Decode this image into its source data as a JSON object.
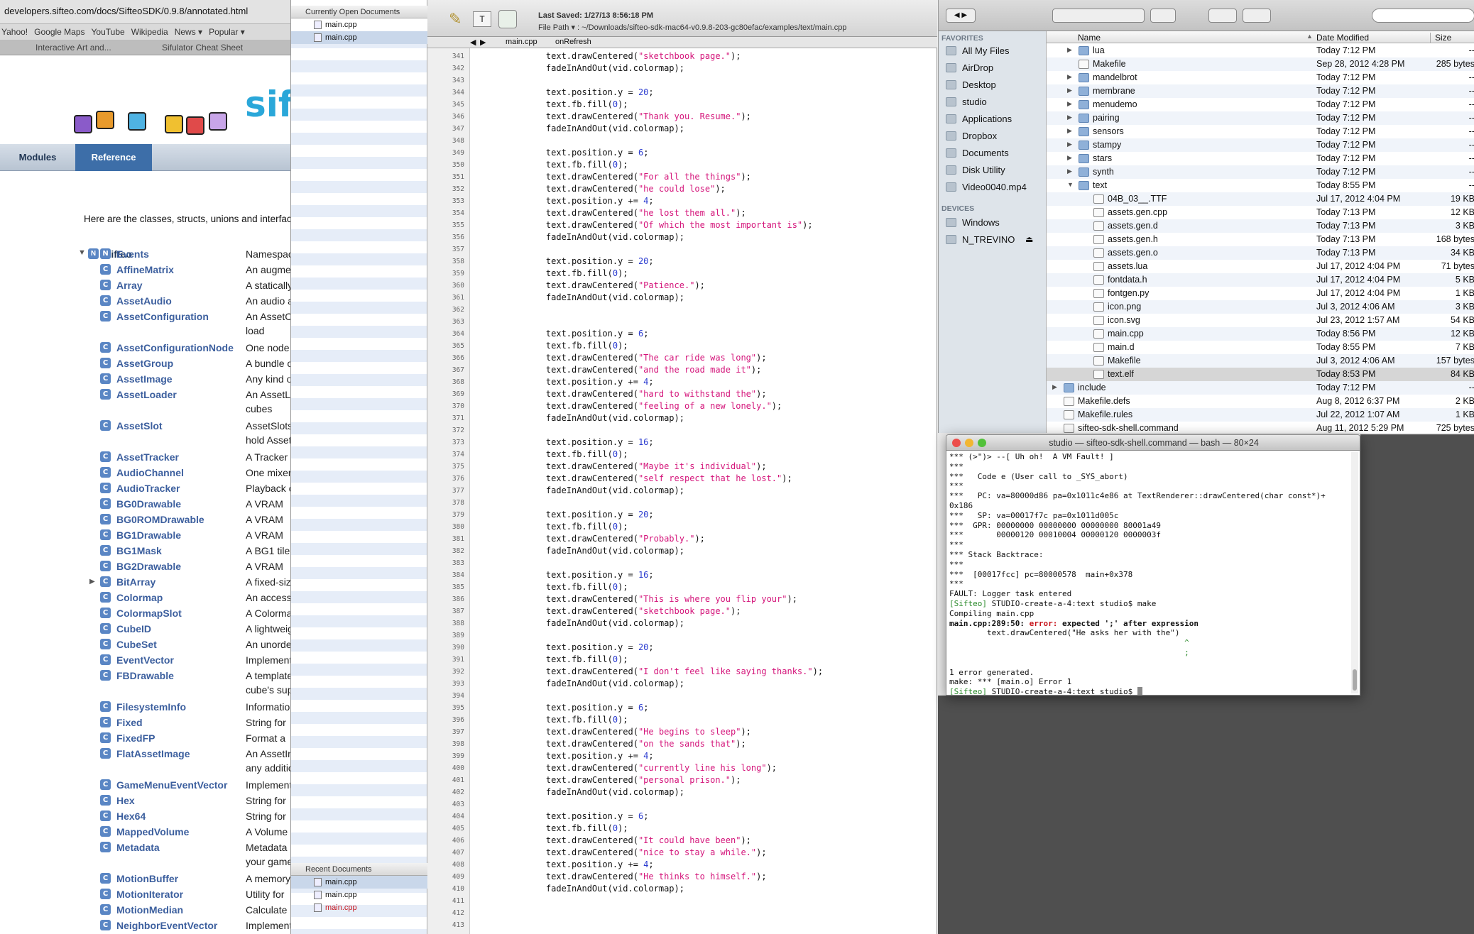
{
  "browser": {
    "url": "developers.sifteo.com/docs/SifteoSDK/0.9.8/annotated.html",
    "bookmarks": [
      "Yahoo!",
      "Google Maps",
      "YouTube",
      "Wikipedia",
      "News ▾",
      "Popular ▾"
    ],
    "tabs": [
      "Interactive Art and...",
      "Sifulator Cheat Sheet"
    ],
    "logo_text": "sift",
    "nav": {
      "modules": "Modules",
      "reference": "Reference"
    },
    "intro": "Here are the classes, structs, unions and interfaces",
    "namespace": "Sifteo",
    "classes": [
      {
        "icon": "N",
        "name": "Events",
        "desc": "Namespace"
      },
      {
        "icon": "C",
        "name": "AffineMatrix",
        "desc": "An augmented"
      },
      {
        "icon": "C",
        "name": "Array",
        "desc": "A statically"
      },
      {
        "icon": "C",
        "name": "AssetAudio",
        "desc": "An audio asset"
      },
      {
        "icon": "C",
        "name": "AssetConfiguration",
        "desc": "An AssetConfiguration",
        "desc2": "load"
      },
      {
        "icon": "C",
        "name": "AssetConfigurationNode",
        "desc": "One node"
      },
      {
        "icon": "C",
        "name": "AssetGroup",
        "desc": "A bundle of"
      },
      {
        "icon": "C",
        "name": "AssetImage",
        "desc": "Any kind of"
      },
      {
        "icon": "C",
        "name": "AssetLoader",
        "desc": "An AssetLoader",
        "desc2": "cubes"
      },
      {
        "icon": "C",
        "name": "AssetSlot",
        "desc": "AssetSlots",
        "desc2": "hold Assets"
      },
      {
        "icon": "C",
        "name": "AssetTracker",
        "desc": "A Tracker"
      },
      {
        "icon": "C",
        "name": "AudioChannel",
        "desc": "One mixer"
      },
      {
        "icon": "C",
        "name": "AudioTracker",
        "desc": "Playback of"
      },
      {
        "icon": "C",
        "name": "BG0Drawable",
        "desc": "A VRAM"
      },
      {
        "icon": "C",
        "name": "BG0ROMDrawable",
        "desc": "A VRAM"
      },
      {
        "icon": "C",
        "name": "BG1Drawable",
        "desc": "A VRAM"
      },
      {
        "icon": "C",
        "name": "BG1Mask",
        "desc": "A BG1 tile"
      },
      {
        "icon": "C",
        "name": "BG2Drawable",
        "desc": "A VRAM"
      },
      {
        "icon": "C",
        "name": "BitArray",
        "desc": "A fixed-size"
      },
      {
        "icon": "C",
        "name": "Colormap",
        "desc": "An accessor"
      },
      {
        "icon": "C",
        "name": "ColormapSlot",
        "desc": "A Colormap"
      },
      {
        "icon": "C",
        "name": "CubeID",
        "desc": "A lightweight"
      },
      {
        "icon": "C",
        "name": "CubeSet",
        "desc": "An unordered"
      },
      {
        "icon": "C",
        "name": "EventVector",
        "desc": "Implements"
      },
      {
        "icon": "C",
        "name": "FBDrawable",
        "desc": "A template",
        "desc2": "cube's sup"
      },
      {
        "icon": "C",
        "name": "FilesystemInfo",
        "desc": "Information"
      },
      {
        "icon": "C",
        "name": "Fixed",
        "desc": "String for"
      },
      {
        "icon": "C",
        "name": "FixedFP",
        "desc": "Format a"
      },
      {
        "icon": "C",
        "name": "FlatAssetImage",
        "desc": "An AssetImage",
        "desc2": "any additional"
      },
      {
        "icon": "C",
        "name": "GameMenuEventVector",
        "desc": "Implements"
      },
      {
        "icon": "C",
        "name": "Hex",
        "desc": "String for"
      },
      {
        "icon": "C",
        "name": "Hex64",
        "desc": "String for"
      },
      {
        "icon": "C",
        "name": "MappedVolume",
        "desc": "A Volume"
      },
      {
        "icon": "C",
        "name": "Metadata",
        "desc": "Metadata",
        "desc2": "your game"
      },
      {
        "icon": "C",
        "name": "MotionBuffer",
        "desc": "A memory"
      },
      {
        "icon": "C",
        "name": "MotionIterator",
        "desc": "Utility for"
      },
      {
        "icon": "C",
        "name": "MotionMedian",
        "desc": "Calculate"
      },
      {
        "icon": "C",
        "name": "NeighborEventVector",
        "desc": "Implements"
      }
    ]
  },
  "editor": {
    "open_docs_label": "Currently Open Documents",
    "open_docs": [
      "main.cpp",
      "main.cpp"
    ],
    "recent_docs_label": "Recent Documents",
    "recent_docs": [
      "main.cpp",
      "main.cpp",
      "main.cpp"
    ],
    "last_saved": "Last Saved: 1/27/13 8:56:18 PM",
    "file_path": "File Path ▾ : ~/Downloads/sifteo-sdk-mac64-v0.9.8-203-gc80efac/examples/text/main.cpp",
    "nav_file": "main.cpp",
    "nav_func": "onRefresh",
    "first_line": 341,
    "lines": [
      "    text.drawCentered(\"sketchbook page.\");",
      "    fadeInAndOut(vid.colormap);",
      "",
      "    text.position.y = 20;",
      "    text.fb.fill(0);",
      "    text.drawCentered(\"Thank you. Resume.\");",
      "    fadeInAndOut(vid.colormap);",
      "",
      "    text.position.y = 6;",
      "    text.fb.fill(0);",
      "    text.drawCentered(\"For all the things\");",
      "    text.drawCentered(\"he could lose\");",
      "    text.position.y += 4;",
      "    text.drawCentered(\"he lost them all.\");",
      "    text.drawCentered(\"Of which the most important is\");",
      "    fadeInAndOut(vid.colormap);",
      "",
      "    text.position.y = 20;",
      "    text.fb.fill(0);",
      "    text.drawCentered(\"Patience.\");",
      "    fadeInAndOut(vid.colormap);",
      "",
      "",
      "    text.position.y = 6;",
      "    text.fb.fill(0);",
      "    text.drawCentered(\"The car ride was long\");",
      "    text.drawCentered(\"and the road made it\");",
      "    text.position.y += 4;",
      "    text.drawCentered(\"hard to withstand the\");",
      "    text.drawCentered(\"feeling of a new lonely.\");",
      "    fadeInAndOut(vid.colormap);",
      "",
      "    text.position.y = 16;",
      "    text.fb.fill(0);",
      "    text.drawCentered(\"Maybe it's individual\");",
      "    text.drawCentered(\"self respect that he lost.\");",
      "    fadeInAndOut(vid.colormap);",
      "",
      "    text.position.y = 20;",
      "    text.fb.fill(0);",
      "    text.drawCentered(\"Probably.\");",
      "    fadeInAndOut(vid.colormap);",
      "",
      "    text.position.y = 16;",
      "    text.fb.fill(0);",
      "    text.drawCentered(\"This is where you flip your\");",
      "    text.drawCentered(\"sketchbook page.\");",
      "    fadeInAndOut(vid.colormap);",
      "",
      "    text.position.y = 20;",
      "    text.fb.fill(0);",
      "    text.drawCentered(\"I don't feel like saying thanks.\");",
      "    fadeInAndOut(vid.colormap);",
      "",
      "    text.position.y = 6;",
      "    text.fb.fill(0);",
      "    text.drawCentered(\"He begins to sleep\");",
      "    text.drawCentered(\"on the sands that\");",
      "    text.position.y += 4;",
      "    text.drawCentered(\"currently line his long\");",
      "    text.drawCentered(\"personal prison.\");",
      "    fadeInAndOut(vid.colormap);",
      "",
      "    text.position.y = 6;",
      "    text.fb.fill(0);",
      "    text.drawCentered(\"It could have been\");",
      "    text.drawCentered(\"nice to stay a while.\");",
      "    text.position.y += 4;",
      "    text.drawCentered(\"He thinks to himself.\");",
      "    fadeInAndOut(vid.colormap);",
      "",
      "",
      ""
    ]
  },
  "finder": {
    "favorites_label": "FAVORITES",
    "favorites": [
      "All My Files",
      "AirDrop",
      "Desktop",
      "studio",
      "Applications",
      "Dropbox",
      "Documents",
      "Disk Utility",
      "Video0040.mp4"
    ],
    "devices_label": "DEVICES",
    "devices": [
      "Windows",
      "N_TREVINO"
    ],
    "columns": {
      "name": "Name",
      "date": "Date Modified",
      "size": "Size"
    },
    "rows": [
      {
        "indent": 1,
        "tw": "▶",
        "kind": "folder",
        "name": "lua",
        "date": "Today 7:12 PM",
        "size": "--"
      },
      {
        "indent": 1,
        "tw": "",
        "kind": "doc",
        "name": "Makefile",
        "date": "Sep 28, 2012 4:28 PM",
        "size": "285 bytes"
      },
      {
        "indent": 1,
        "tw": "▶",
        "kind": "folder",
        "name": "mandelbrot",
        "date": "Today 7:12 PM",
        "size": "--"
      },
      {
        "indent": 1,
        "tw": "▶",
        "kind": "folder",
        "name": "membrane",
        "date": "Today 7:12 PM",
        "size": "--"
      },
      {
        "indent": 1,
        "tw": "▶",
        "kind": "folder",
        "name": "menudemo",
        "date": "Today 7:12 PM",
        "size": "--"
      },
      {
        "indent": 1,
        "tw": "▶",
        "kind": "folder",
        "name": "pairing",
        "date": "Today 7:12 PM",
        "size": "--"
      },
      {
        "indent": 1,
        "tw": "▶",
        "kind": "folder",
        "name": "sensors",
        "date": "Today 7:12 PM",
        "size": "--"
      },
      {
        "indent": 1,
        "tw": "▶",
        "kind": "folder",
        "name": "stampy",
        "date": "Today 7:12 PM",
        "size": "--"
      },
      {
        "indent": 1,
        "tw": "▶",
        "kind": "folder",
        "name": "stars",
        "date": "Today 7:12 PM",
        "size": "--"
      },
      {
        "indent": 1,
        "tw": "▶",
        "kind": "folder",
        "name": "synth",
        "date": "Today 7:12 PM",
        "size": "--"
      },
      {
        "indent": 1,
        "tw": "▼",
        "kind": "folder",
        "name": "text",
        "date": "Today 8:55 PM",
        "size": "--"
      },
      {
        "indent": 2,
        "tw": "",
        "kind": "doc",
        "name": "04B_03__.TTF",
        "date": "Jul 17, 2012 4:04 PM",
        "size": "19 KB"
      },
      {
        "indent": 2,
        "tw": "",
        "kind": "doc",
        "name": "assets.gen.cpp",
        "date": "Today 7:13 PM",
        "size": "12 KB"
      },
      {
        "indent": 2,
        "tw": "",
        "kind": "doc",
        "name": "assets.gen.d",
        "date": "Today 7:13 PM",
        "size": "3 KB"
      },
      {
        "indent": 2,
        "tw": "",
        "kind": "doc",
        "name": "assets.gen.h",
        "date": "Today 7:13 PM",
        "size": "168 bytes"
      },
      {
        "indent": 2,
        "tw": "",
        "kind": "doc",
        "name": "assets.gen.o",
        "date": "Today 7:13 PM",
        "size": "34 KB"
      },
      {
        "indent": 2,
        "tw": "",
        "kind": "doc",
        "name": "assets.lua",
        "date": "Jul 17, 2012 4:04 PM",
        "size": "71 bytes"
      },
      {
        "indent": 2,
        "tw": "",
        "kind": "doc",
        "name": "fontdata.h",
        "date": "Jul 17, 2012 4:04 PM",
        "size": "5 KB"
      },
      {
        "indent": 2,
        "tw": "",
        "kind": "doc",
        "name": "fontgen.py",
        "date": "Jul 17, 2012 4:04 PM",
        "size": "1 KB"
      },
      {
        "indent": 2,
        "tw": "",
        "kind": "doc",
        "name": "icon.png",
        "date": "Jul 3, 2012 4:06 AM",
        "size": "3 KB"
      },
      {
        "indent": 2,
        "tw": "",
        "kind": "doc",
        "name": "icon.svg",
        "date": "Jul 23, 2012 1:57 AM",
        "size": "54 KB"
      },
      {
        "indent": 2,
        "tw": "",
        "kind": "doc",
        "name": "main.cpp",
        "date": "Today 8:56 PM",
        "size": "12 KB"
      },
      {
        "indent": 2,
        "tw": "",
        "kind": "doc",
        "name": "main.d",
        "date": "Today 8:55 PM",
        "size": "7 KB"
      },
      {
        "indent": 2,
        "tw": "",
        "kind": "doc",
        "name": "Makefile",
        "date": "Jul 3, 2012 4:06 AM",
        "size": "157 bytes"
      },
      {
        "indent": 2,
        "tw": "",
        "kind": "doc",
        "name": "text.elf",
        "date": "Today 8:53 PM",
        "size": "84 KB",
        "selected": true
      },
      {
        "indent": 0,
        "tw": "▶",
        "kind": "folder",
        "name": "include",
        "date": "Today 7:12 PM",
        "size": "--"
      },
      {
        "indent": 0,
        "tw": "",
        "kind": "doc",
        "name": "Makefile.defs",
        "date": "Aug 8, 2012 6:37 PM",
        "size": "2 KB"
      },
      {
        "indent": 0,
        "tw": "",
        "kind": "doc",
        "name": "Makefile.rules",
        "date": "Jul 22, 2012 1:07 AM",
        "size": "1 KB"
      },
      {
        "indent": 0,
        "tw": "",
        "kind": "doc",
        "name": "sifteo-sdk-shell.command",
        "date": "Aug 11, 2012 5:29 PM",
        "size": "725 bytes"
      }
    ]
  },
  "terminal": {
    "title": "studio — sifteo-sdk-shell.command — bash — 80×24",
    "lines": [
      {
        "t": "*** (>\")> --[ Uh oh!  A VM Fault! ]",
        "c": ""
      },
      {
        "t": "***",
        "c": ""
      },
      {
        "t": "***   Code e (User call to _SYS_abort)",
        "c": ""
      },
      {
        "t": "***",
        "c": ""
      },
      {
        "t": "***   PC: va=80000d86 pa=0x1011c4e86 at TextRenderer::drawCentered(char const*)+",
        "c": ""
      },
      {
        "t": "0x186",
        "c": ""
      },
      {
        "t": "***   SP: va=00017f7c pa=0x1011d005c",
        "c": ""
      },
      {
        "t": "***  GPR: 00000000 00000000 00000000 80001a49",
        "c": ""
      },
      {
        "t": "***       00000120 00010004 00000120 0000003f",
        "c": ""
      },
      {
        "t": "***",
        "c": ""
      },
      {
        "t": "*** Stack Backtrace:",
        "c": ""
      },
      {
        "t": "***",
        "c": ""
      },
      {
        "t": "***  [00017fcc] pc=80000578  main+0x378",
        "c": ""
      },
      {
        "t": "***",
        "c": ""
      },
      {
        "t": "FAULT: Logger task entered",
        "c": ""
      },
      {
        "t": "[Sifteo] STUDIO-create-a-4:text studio$ make",
        "c": "prompt"
      },
      {
        "t": "Compiling main.cpp",
        "c": ""
      },
      {
        "t": "main.cpp:289:50: error: expected ';' after expression",
        "c": "error"
      },
      {
        "t": "        text.drawCentered(\"He asks her with the\")",
        "c": ""
      },
      {
        "t": "                                                  ^",
        "c": "green"
      },
      {
        "t": "                                                  ;",
        "c": "green"
      },
      {
        "t": "",
        "c": ""
      },
      {
        "t": "1 error generated.",
        "c": ""
      },
      {
        "t": "make: *** [main.o] Error 1",
        "c": ""
      },
      {
        "t": "[Sifteo] STUDIO-create-a-4:text studio$ ",
        "c": "prompt"
      }
    ]
  }
}
